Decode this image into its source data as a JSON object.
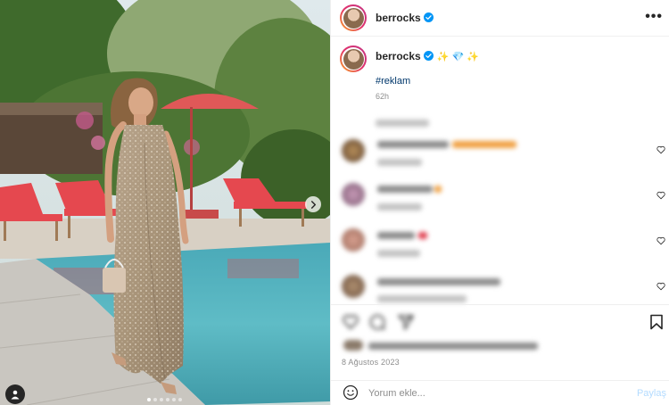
{
  "post": {
    "username": "berrocks",
    "verified": true,
    "caption_emojis": "✨ 💎 ✨",
    "hashtag": "#reklam",
    "time_ago": "62h",
    "date": "8 Ağustos 2023",
    "carousel": {
      "slides": 6,
      "active_index": 0
    }
  },
  "header": {
    "more_label": "•••"
  },
  "comment_box": {
    "placeholder": "Yorum ekle...",
    "share_label": "Paylaş"
  },
  "icons": {
    "verified": "verified-badge-icon",
    "more": "more-options-icon",
    "next": "chevron-right-icon",
    "tags": "user-tag-icon",
    "like": "heart-icon",
    "comment": "comment-icon",
    "share": "share-icon",
    "save": "bookmark-icon",
    "emoji": "emoji-icon"
  },
  "colors": {
    "accent": "#0095f6",
    "verified": "#0095f6",
    "share_disabled": "#b3dbff",
    "muted": "#8e8e8e"
  }
}
